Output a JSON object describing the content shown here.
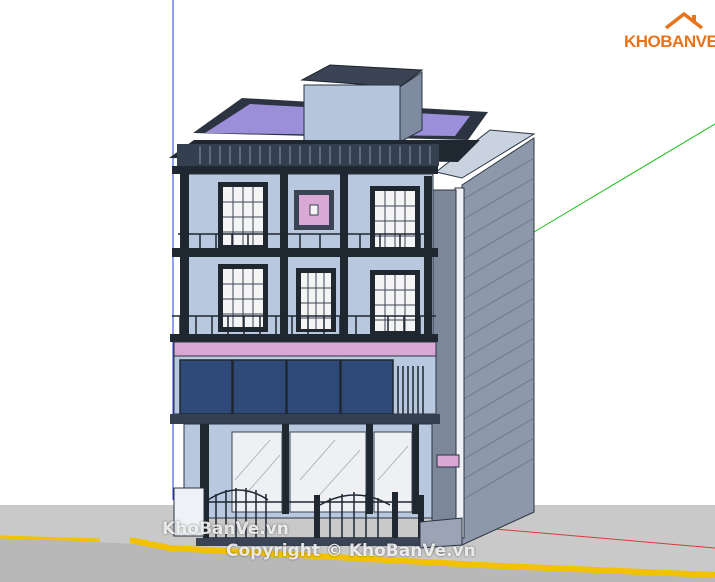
{
  "brand": {
    "logo_text": "KHOBANVE"
  },
  "watermarks": {
    "left": "KhoBanVe.vn",
    "copyright": "Copyright © KhoBanVe.vn"
  },
  "colors": {
    "wall_light": "#b8c8de",
    "wall_side": "#8a96a8",
    "roof_dark": "#2b3440",
    "trim_pink": "#d9a8d4",
    "glass_blue": "#2f4a78",
    "ground": "#c9c9c9",
    "road_edge": "#f2c200",
    "axis_green": "#19c219",
    "axis_red": "#d83a3a",
    "axis_blue": "#2b3fd0",
    "logo_orange": "#e8731a"
  }
}
